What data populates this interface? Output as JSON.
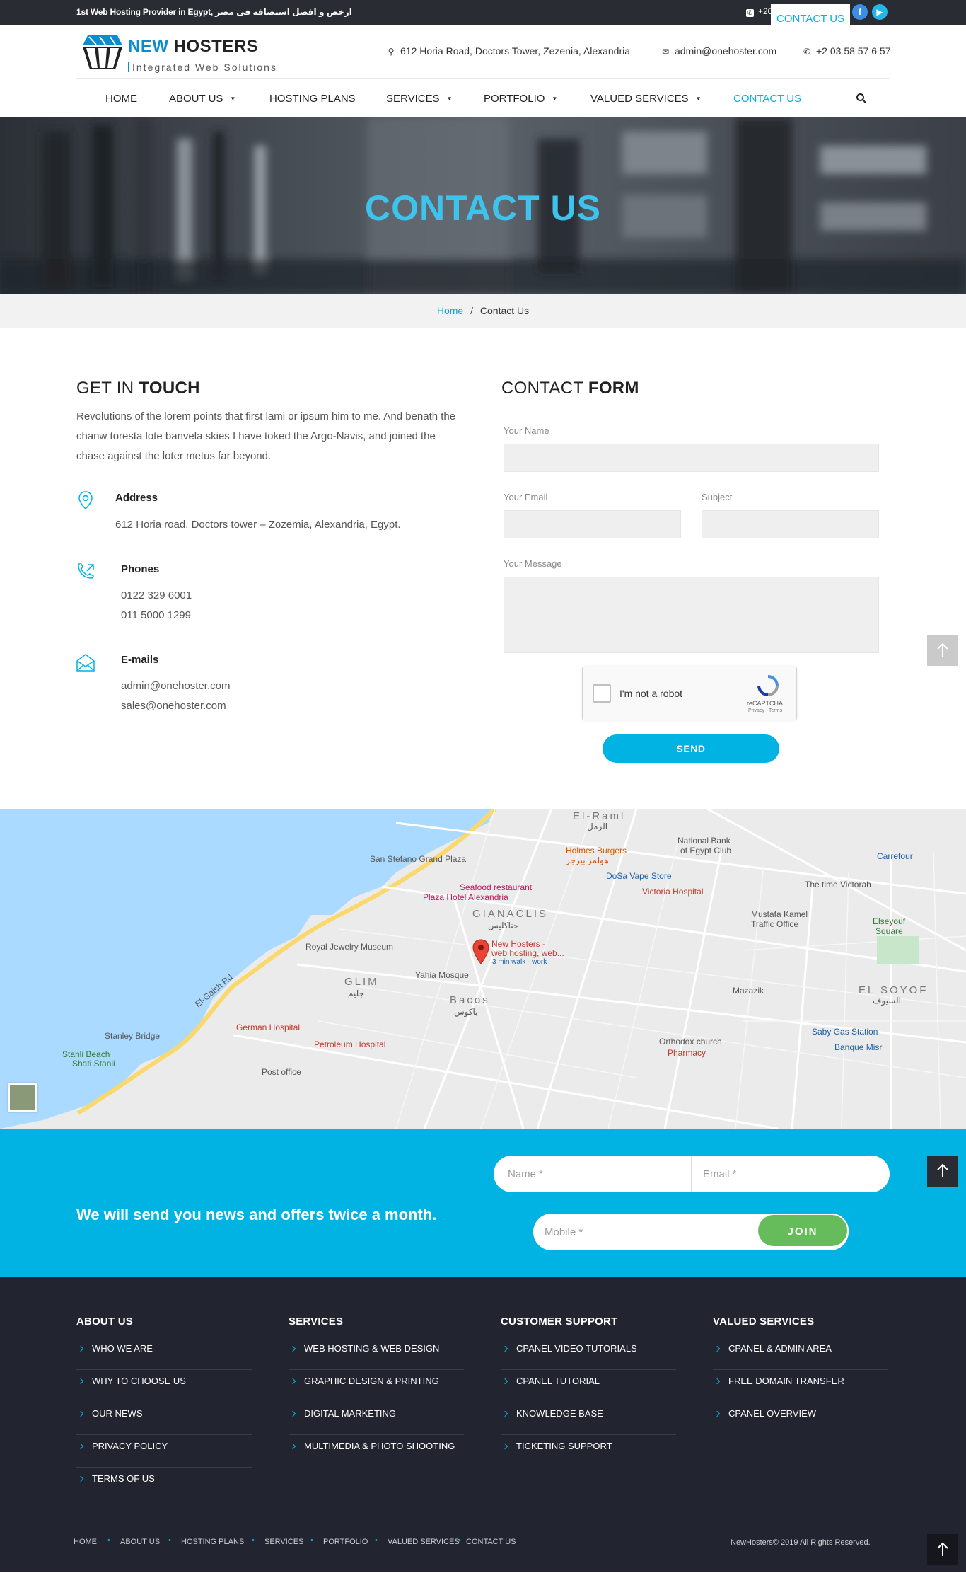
{
  "topbar": {
    "tagline": "1st Web Hosting Provider in Egypt, ارخص و افضل استضافة فى مصر",
    "phone": "+2012 23 29 60 01",
    "cta": "CONTACT US"
  },
  "header": {
    "logo_name_a": "NEW",
    "logo_name_b": " HOSTERS",
    "logo_sub": "Integrated Web Solutions",
    "address": "612 Horia Road, Doctors Tower, Zezenia, Alexandria",
    "email": "admin@onehoster.com",
    "phone": "+2 03 58 57 6 57"
  },
  "nav": {
    "items": [
      {
        "label": "HOME"
      },
      {
        "label": "ABOUT US"
      },
      {
        "label": "HOSTING PLANS"
      },
      {
        "label": "SERVICES"
      },
      {
        "label": "PORTFOLIO"
      },
      {
        "label": "VALUED SERVICES"
      },
      {
        "label": "CONTACT US"
      }
    ]
  },
  "hero": {
    "title": "CONTACT US"
  },
  "breadcrumb": {
    "home": "Home",
    "sep": "/",
    "current": "Contact Us"
  },
  "touch": {
    "title_a": "GET IN ",
    "title_b": "TOUCH",
    "lead": "Revolutions of the lorem points that first lami or ipsum him to me. And benath the chanw toresta lote banvela skies I have toked the Argo-Navis, and joined the chase against the loter metus far beyond.",
    "address_label": "Address",
    "address": "612 Horia road, Doctors tower – Zozemia, Alexandria, Egypt.",
    "phones_label": "Phones",
    "phone1": "0122 329 6001",
    "phone2": "011 5000 1299",
    "emails_label": "E-mails",
    "email1": "admin@onehoster.com",
    "email2": "sales@onehoster.com"
  },
  "form": {
    "title_a": "CONTACT ",
    "title_b": "FORM",
    "name_label": "Your Name",
    "email_label": "Your Email",
    "subject_label": "Subject",
    "message_label": "Your Message",
    "captcha_text": "I'm not a robot",
    "captcha_brand": "reCAPTCHA",
    "captcha_terms": "Privacy - Terms",
    "send": "SEND"
  },
  "map": {
    "labels": {
      "el_raml": "El-Raml",
      "el_raml_ar": "الرمل",
      "holmes": "Holmes Burgers",
      "holmes_ar": "هولمز بيرجر",
      "national_bank": "National Bank",
      "egypt_club": "of Egypt Club",
      "carrefour": "Carrefour",
      "stefano": "San Stefano Grand Plaza",
      "dosa": "DoSa Vape Store",
      "seafood": "Seafood restaurant",
      "plaza": "Plaza Hotel Alexandria",
      "victoria": "Victoria Hospital",
      "time_victorah": "The time Victorah",
      "gianaclis": "GIANACLIS",
      "gianaclis_ar": "جناكليس",
      "new_hosters": "New Hosters -",
      "new_hosters2": "web hosting, web...",
      "walk": "3 min walk · work",
      "jewelry": "Royal Jewelry Museum",
      "mustafa": "Mustafa Kamel",
      "traffic": "Traffic Office",
      "elseyouf": "Elseyouf",
      "square": "Square",
      "yahia": "Yahia Mosque",
      "glim": "GLIM",
      "glim_ar": "جليم",
      "bacos": "Bacos",
      "bacos_ar": "باكوس",
      "el_soyof": "EL SOYOF",
      "el_soyof_ar": "السيوف",
      "german": "German Hospital",
      "mazazik": "Mazazik",
      "church": "Orthodox church",
      "saby": "Saby Gas Station",
      "stanley": "Stanley Bridge",
      "stanli": "Stanli Beach",
      "shati": "Shati Stanli",
      "petroleum": "Petroleum Hospital",
      "banque": "Banque Misr",
      "post": "Post office",
      "pharmacy": "Pharmacy",
      "elgaish": "El-Gaish Rd"
    }
  },
  "newsletter": {
    "message": "We will send you news and offers twice a month.",
    "name_ph": "Name *",
    "email_ph": "Email *",
    "mobile_ph": "Mobile *",
    "join": "JOIN"
  },
  "footer": {
    "cols": [
      {
        "title": "ABOUT US",
        "links": [
          "WHO WE ARE",
          "WHY TO CHOOSE US",
          "OUR NEWS",
          "PRIVACY POLICY",
          "TERMS OF US"
        ]
      },
      {
        "title": "SERVICES",
        "links": [
          "WEB HOSTING & WEB DESIGN",
          "GRAPHIC DESIGN & PRINTING",
          "DIGITAL MARKETING",
          "MULTIMEDIA & PHOTO SHOOTING"
        ]
      },
      {
        "title": "CUSTOMER SUPPORT",
        "links": [
          "CPANEL VIDEO TUTORIALS",
          "CPANEL TUTORIAL",
          "KNOWLEDGE BASE",
          "TICKETING SUPPORT"
        ]
      },
      {
        "title": "VALUED SERVICES",
        "links": [
          "CPANEL & ADMIN AREA",
          "FREE DOMAIN TRANSFER",
          "CPANEL OVERVIEW"
        ]
      }
    ],
    "bottom_links": [
      "HOME",
      "ABOUT US",
      "HOSTING PLANS",
      "SERVICES",
      "PORTFOLIO",
      "VALUED SERVICES",
      "CONTACT US"
    ],
    "copyright": "NewHosters© 2019 All Rights Reserved."
  },
  "colors": {
    "accent": "#00b3e3",
    "dark": "#2a2c34",
    "footer": "#222530",
    "join": "#66bb5a"
  }
}
